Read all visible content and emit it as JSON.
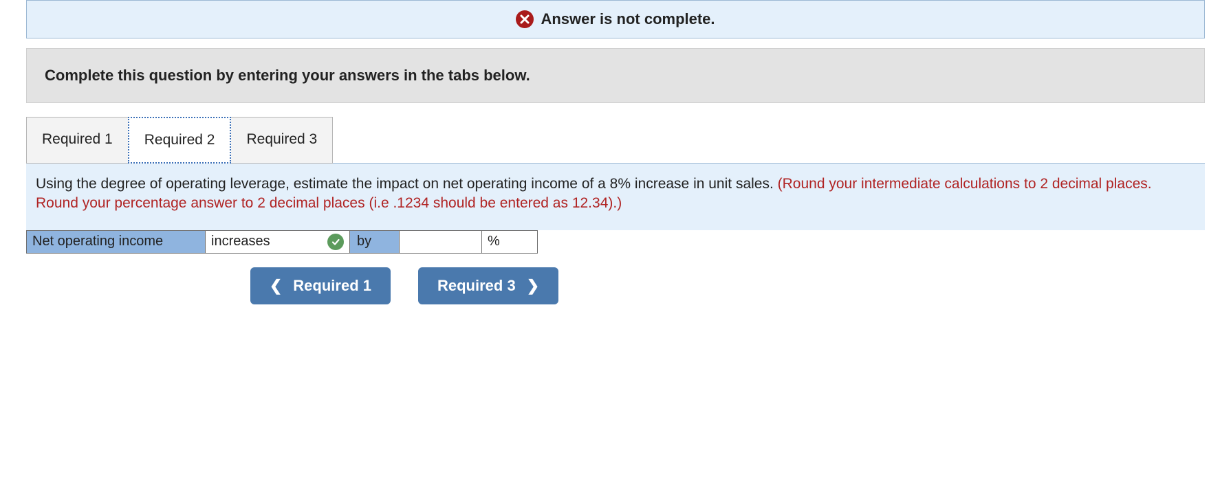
{
  "status": {
    "message": "Answer is not complete."
  },
  "instruction": "Complete this question by entering your answers in the tabs below.",
  "tabs": [
    {
      "label": "Required 1",
      "active": false
    },
    {
      "label": "Required 2",
      "active": true
    },
    {
      "label": "Required 3",
      "active": false
    }
  ],
  "question": {
    "prompt": "Using the degree of operating leverage, estimate the impact on net operating income of a 8% increase in unit sales. ",
    "hint": "(Round your intermediate calculations to 2 decimal places. Round your percentage answer to 2 decimal places (i.e .1234 should be entered as 12.34).)"
  },
  "answer": {
    "row_label": "Net operating income",
    "direction_value": "increases",
    "by_label": "by",
    "percent_value": "",
    "unit": "%"
  },
  "nav": {
    "prev_label": "Required 1",
    "next_label": "Required 3"
  }
}
